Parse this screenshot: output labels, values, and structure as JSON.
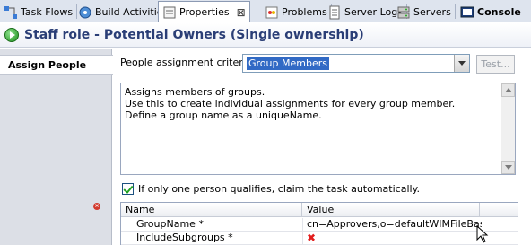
{
  "tabs": [
    {
      "label": "Task Flows",
      "icon": "task-flows-icon"
    },
    {
      "label": "Build Activities",
      "icon": "build-activities-icon"
    },
    {
      "label": "Properties",
      "icon": "properties-icon",
      "active": true,
      "close": "⊠"
    },
    {
      "label": "Problems",
      "icon": "problems-icon"
    },
    {
      "label": "Server Logs",
      "icon": "server-logs-icon"
    },
    {
      "label": "Servers",
      "icon": "servers-icon"
    },
    {
      "label": "Console",
      "icon": "console-icon",
      "bold": true
    }
  ],
  "header": {
    "title": "Staff role - Potential Owners (Single ownership)",
    "icon": "run-icon"
  },
  "sidebar": {
    "items": [
      {
        "label": "Assign People"
      }
    ]
  },
  "main": {
    "criteria_label": "People assignment criteria:",
    "criteria_value": "Group Members",
    "test_button": "Test...",
    "description_lines": [
      "Assigns members of groups.",
      "Use this to create individual assignments for every group member.",
      "Define a group name as a uniqueName."
    ],
    "auto_claim_label": "If only one person qualifies, claim the task automatically.",
    "auto_claim_checked": true,
    "table": {
      "headers": [
        "Name",
        "Value"
      ],
      "rows": [
        {
          "name": "GroupName *",
          "value": "cn=Approvers,o=defaultWIMFileBas..."
        },
        {
          "name": "IncludeSubgroups *",
          "value": "✖"
        }
      ]
    }
  },
  "colors": {
    "accent": "#316ac5",
    "title": "#2a3e76",
    "error": "#e21d1d"
  }
}
